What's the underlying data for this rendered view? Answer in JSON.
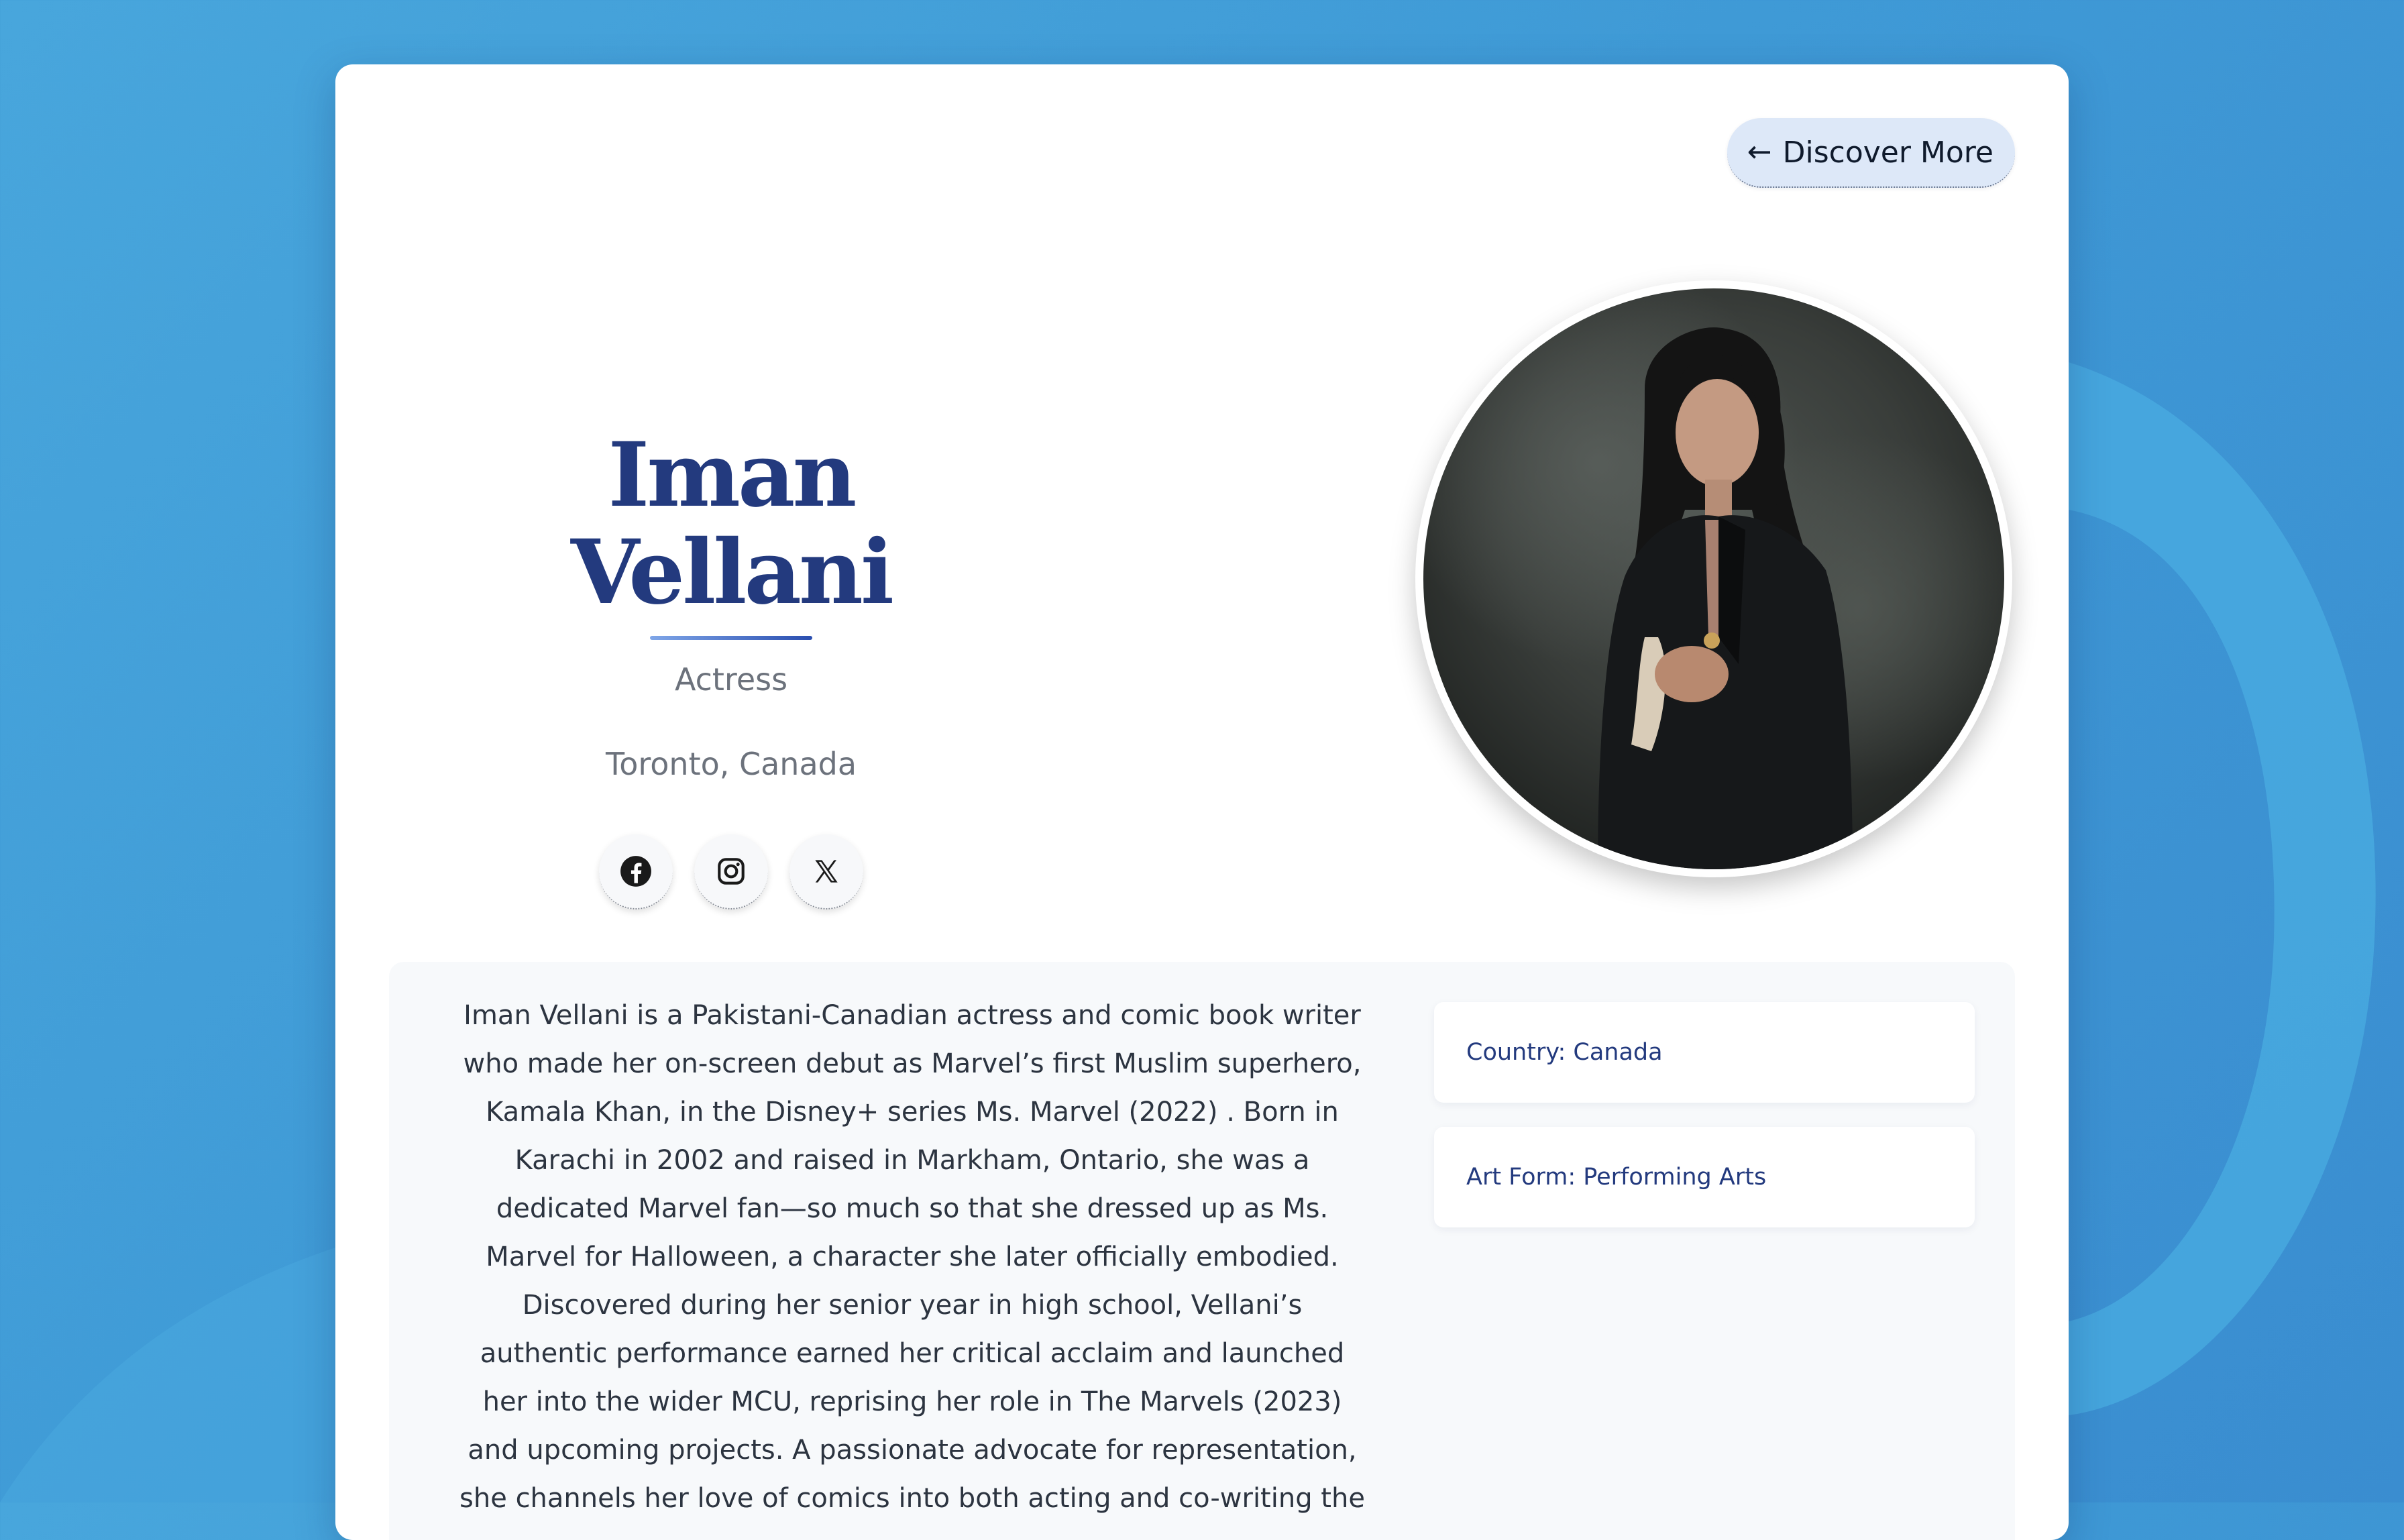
{
  "header": {
    "discover_label": "Discover More",
    "discover_arrow": "←"
  },
  "profile": {
    "name": "Iman Vellani",
    "role": "Actress",
    "location": "Toronto, Canada"
  },
  "socials": [
    {
      "name": "facebook-icon"
    },
    {
      "name": "instagram-icon"
    },
    {
      "name": "x-icon"
    }
  ],
  "bio": {
    "text": "Iman Vellani is a Pakistani-Canadian actress and comic book writer who made her on-screen debut as Marvel’s first Muslim superhero, Kamala Khan, in the Disney+ series Ms. Marvel (2022) . Born in Karachi in 2002 and raised in Markham, Ontario, she was a dedicated Marvel fan—so much so that she dressed up as Ms. Marvel for Halloween, a character she later officially embodied. Discovered during her senior year in high school, Vellani’s authentic performance earned her critical acclaim and launched her into the wider MCU, reprising her role in The Marvels (2023) and upcoming projects. A passionate advocate for representation, she channels her love of comics into both acting and co-writing the"
  },
  "info": {
    "country": "Country: Canada",
    "art_form": "Art Form: Performing Arts"
  },
  "colors": {
    "accent": "#233a7e",
    "background": "#3f9ad6",
    "button_bg": "#dde8f8"
  }
}
